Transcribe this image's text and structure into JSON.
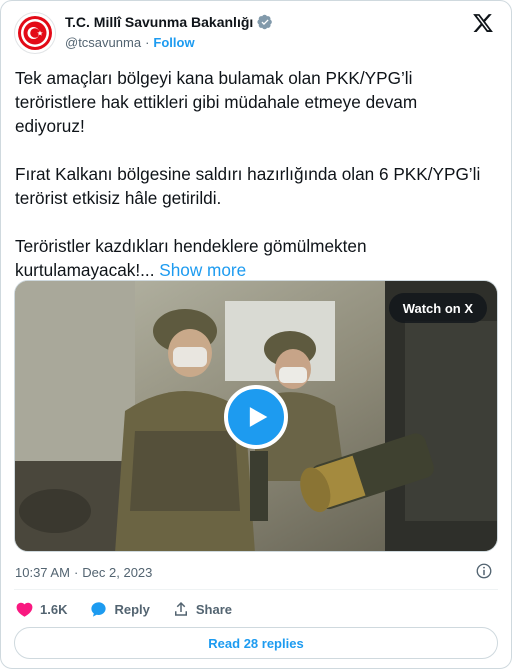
{
  "account": {
    "name": "T.C. Millî Savunma Bakanlığı",
    "handle": "@tcsavunma",
    "separator": "·",
    "follow_label": "Follow"
  },
  "tweet": {
    "paragraph_1": "Tek amaçları bölgeyi kana bulamak olan PKK/YPG’li teröristlere hak ettikleri gibi müdahale etmeye devam ediyoruz!",
    "paragraph_2": "Fırat Kalkanı bölgesine saldırı hazırlığında olan 6 PKK/YPG’li terörist etkisiz hâle getirildi.",
    "paragraph_3": "Teröristler kazdıkları hendeklere gömülmekten kurtulamayacak!...",
    "show_more_label": "Show more"
  },
  "media": {
    "watch_label": "Watch on X",
    "icons": [
      "play-icon"
    ]
  },
  "meta": {
    "time": "10:37 AM",
    "separator": "·",
    "date": "Dec 2, 2023"
  },
  "actions": {
    "like_count": "1.6K",
    "reply_label": "Reply",
    "share_label": "Share"
  },
  "replies": {
    "label": "Read 28 replies"
  },
  "colors": {
    "accent": "#1d9bf0",
    "like": "#f91880",
    "text": "#0f1419",
    "secondary": "#536471",
    "logo_red": "#e30a17"
  }
}
